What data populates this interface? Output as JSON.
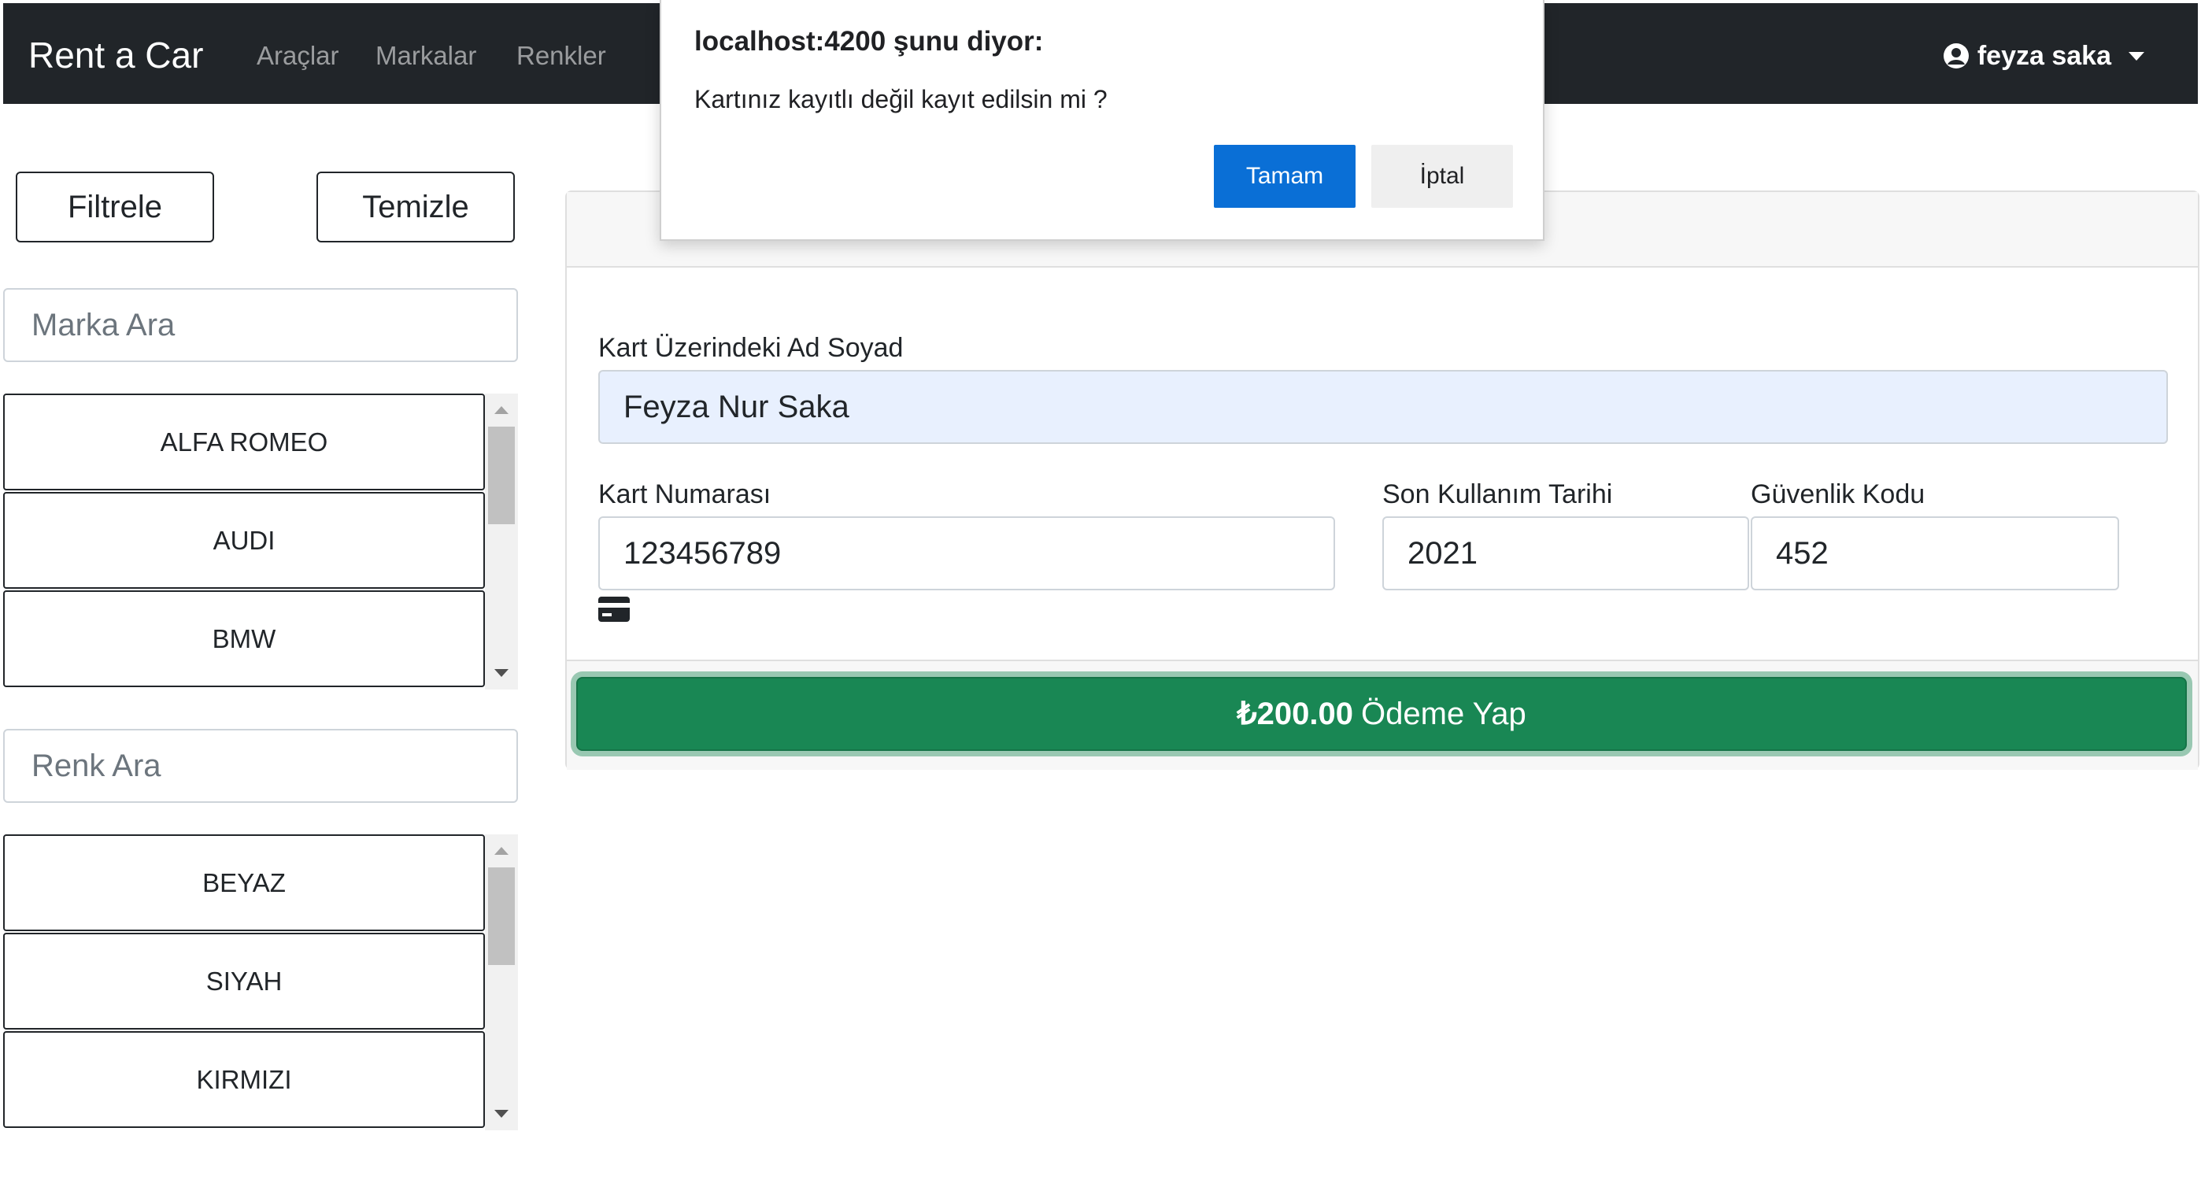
{
  "navbar": {
    "brand": "Rent a Car",
    "links": [
      "Araçlar",
      "Markalar",
      "Renkler"
    ],
    "user_name": "feyza saka",
    "user_icon": "user-circle-icon",
    "dropdown_icon": "caret-down-icon"
  },
  "sidebar": {
    "filter_label": "Filtrele",
    "clear_label": "Temizle",
    "brand_search_placeholder": "Marka Ara",
    "brands": [
      "ALFA ROMEO",
      "AUDI",
      "BMW"
    ],
    "color_search_placeholder": "Renk Ara",
    "colors": [
      "BEYAZ",
      "SIYAH",
      "KIRMIZI"
    ]
  },
  "payment": {
    "name_label": "Kart Üzerindeki Ad Soyad",
    "name_value": "Feyza Nur Saka",
    "card_number_label": "Kart Numarası",
    "card_number_value": "123456789",
    "expiry_label": "Son Kullanım Tarihi",
    "expiry_value": "2021",
    "cvv_label": "Güvenlik Kodu",
    "cvv_value": "452",
    "card_icon": "credit-card-icon",
    "pay_amount": "₺200.00",
    "pay_label": "Ödeme Yap",
    "pay_color": "#198754"
  },
  "dialog": {
    "title": "localhost:4200 şunu diyor:",
    "message": "Kartınız kayıtlı değil kayıt edilsin mi ?",
    "ok_label": "Tamam",
    "cancel_label": "İptal",
    "ok_color": "#0a6fd6"
  }
}
